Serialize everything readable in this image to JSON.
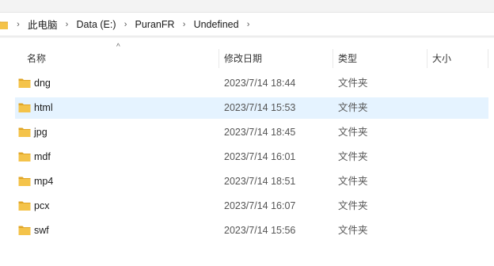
{
  "breadcrumb": {
    "items": [
      "此电脑",
      "Data (E:)",
      "PuranFR",
      "Undefined"
    ]
  },
  "columns": {
    "name": "名称",
    "date": "修改日期",
    "type": "类型",
    "size": "大小"
  },
  "sort": {
    "column": "name",
    "direction": "ascending",
    "indicator": "^"
  },
  "files": [
    {
      "name": "dng",
      "date": "2023/7/14 18:44",
      "type": "文件夹",
      "selected": false
    },
    {
      "name": "html",
      "date": "2023/7/14 15:53",
      "type": "文件夹",
      "selected": true
    },
    {
      "name": "jpg",
      "date": "2023/7/14 18:45",
      "type": "文件夹",
      "selected": false
    },
    {
      "name": "mdf",
      "date": "2023/7/14 16:01",
      "type": "文件夹",
      "selected": false
    },
    {
      "name": "mp4",
      "date": "2023/7/14 18:51",
      "type": "文件夹",
      "selected": false
    },
    {
      "name": "pcx",
      "date": "2023/7/14 16:07",
      "type": "文件夹",
      "selected": false
    },
    {
      "name": "swf",
      "date": "2023/7/14 15:56",
      "type": "文件夹",
      "selected": false
    }
  ],
  "colors": {
    "folder": "#f4c34a",
    "folder_dark": "#e0a526",
    "selection": "#e5f3ff"
  }
}
